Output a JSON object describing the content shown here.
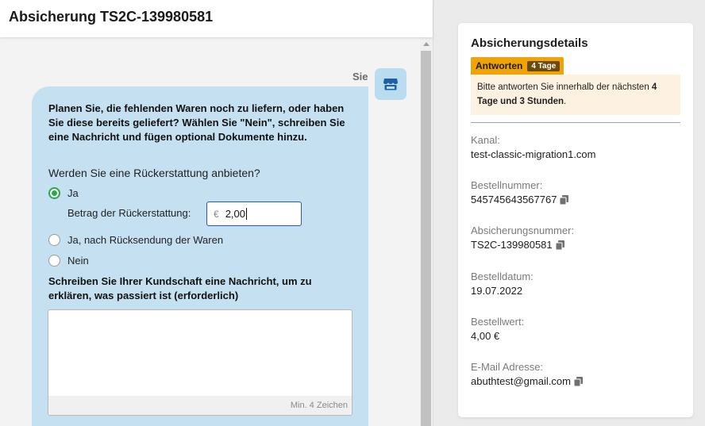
{
  "header": {
    "title": "Absicherung TS2C-139980581"
  },
  "chat": {
    "sender": "Sie",
    "question": "Planen Sie, die fehlenden Waren noch zu liefern, oder haben Sie diese bereits geliefert? Wählen Sie \"Nein\", schreiben Sie eine Nachricht und fügen optional Dokumente hinzu.",
    "refund_question": "Werden Sie eine Rückerstattung anbieten?",
    "options": [
      {
        "label": "Ja",
        "checked": true
      },
      {
        "label": "Ja, nach Rücksendung der Waren",
        "checked": false
      },
      {
        "label": "Nein",
        "checked": false
      }
    ],
    "amount_label": "Betrag der Rückerstattung:",
    "currency": "€",
    "amount_value": "2,00",
    "message_label": "Schreiben Sie Ihrer Kundschaft eine Nachricht, um zu erklären, was passiert ist (erforderlich)",
    "message_value": "",
    "message_hint": "Min. 4 Zeichen"
  },
  "details": {
    "title": "Absicherungsdetails",
    "status_label": "Antworten",
    "status_days": "4 Tage",
    "notice_prefix": "Bitte antworten Sie innerhalb der nächsten ",
    "notice_bold": "4 Tage und 3 Stunden",
    "notice_suffix": ".",
    "fields": [
      {
        "key": "Kanal:",
        "value": "test-classic-migration1.com",
        "copy": false
      },
      {
        "key": "Bestellnummer:",
        "value": "545745643567767",
        "copy": true
      },
      {
        "key": "Absicherungsnummer:",
        "value": "TS2C-139980581",
        "copy": true
      },
      {
        "key": "Bestelldatum:",
        "value": "19.07.2022",
        "copy": false
      },
      {
        "key": "Bestellwert:",
        "value": "4,00 €",
        "copy": false
      },
      {
        "key": "E-Mail Adresse:",
        "value": "abuthtest@gmail.com",
        "copy": true
      }
    ]
  },
  "colors": {
    "accent_green": "#2ba84a",
    "badge_orange": "#f0a307",
    "bubble_blue": "#c5e1f1",
    "input_focus": "#2b55b8"
  }
}
